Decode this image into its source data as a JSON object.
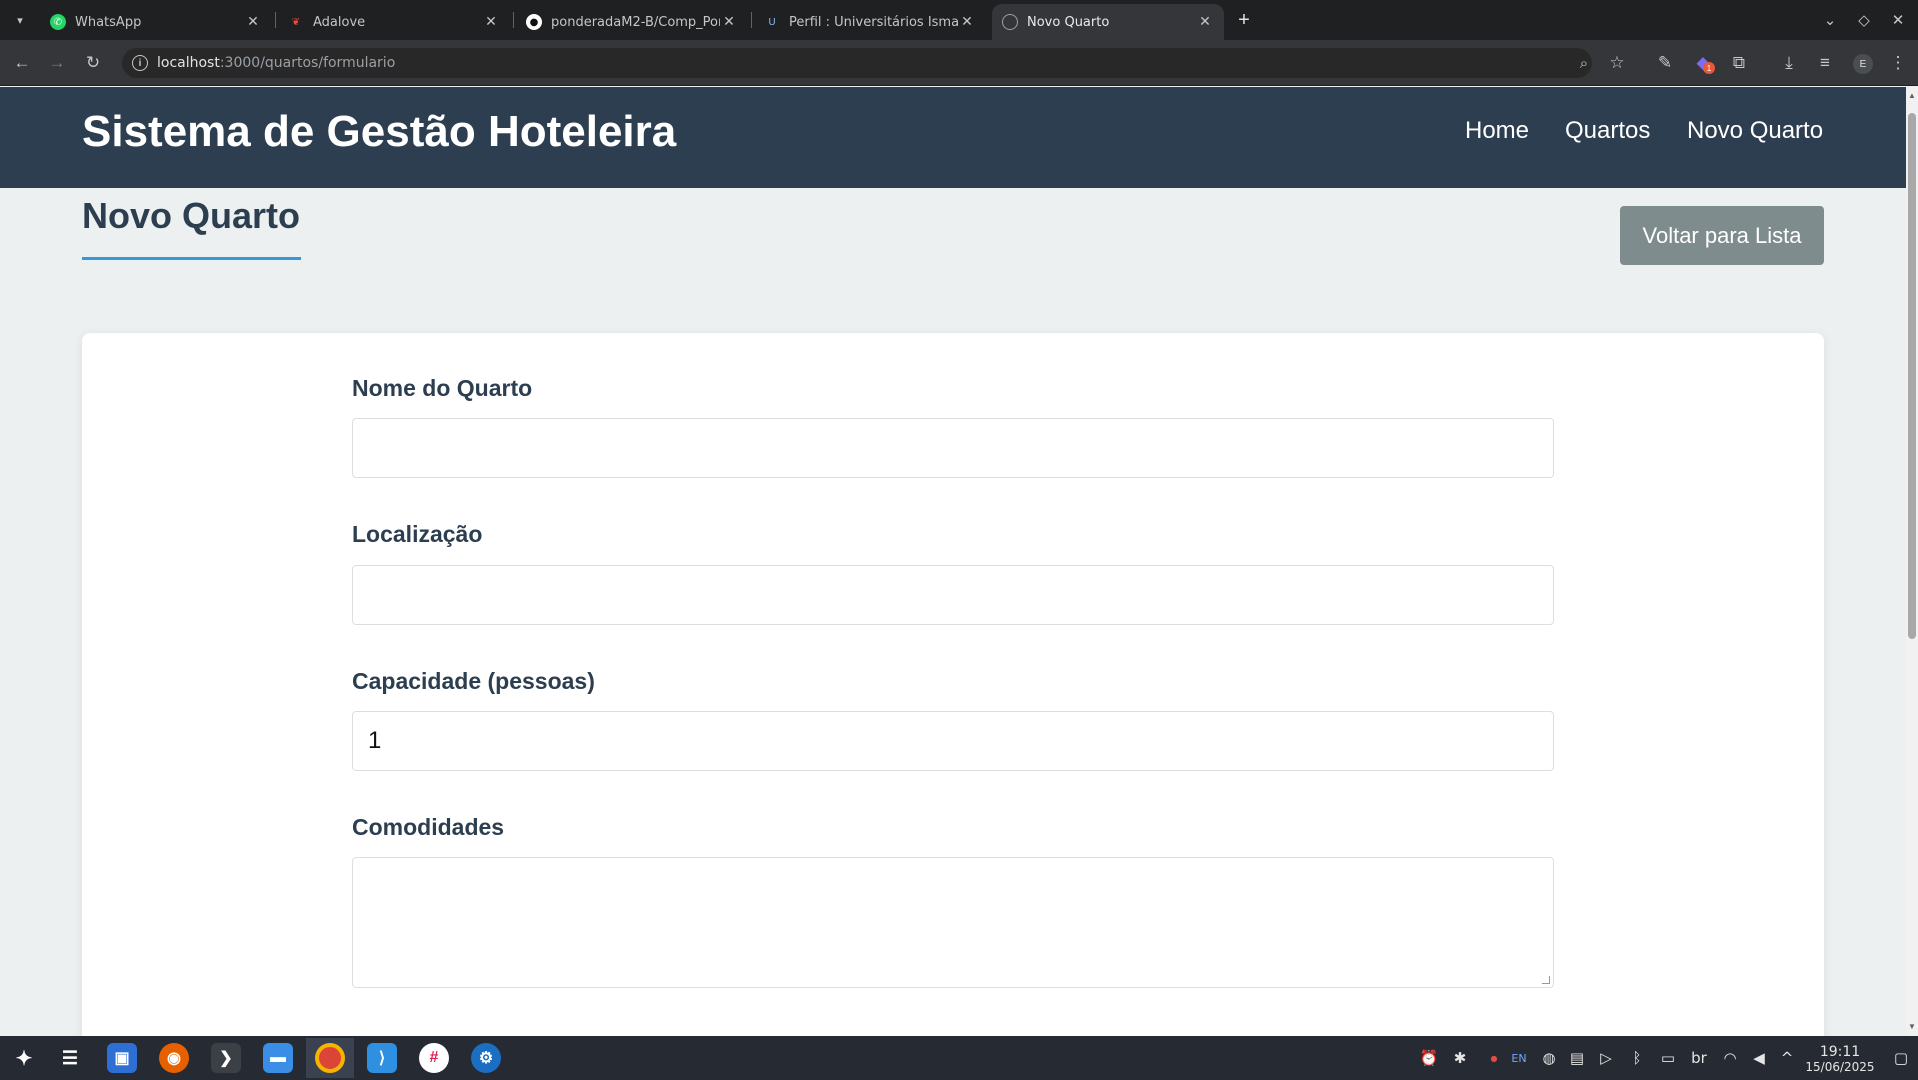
{
  "browser": {
    "tabs": [
      {
        "title": "WhatsApp",
        "icon": "whatsapp-icon",
        "color": "#25d366",
        "active": false
      },
      {
        "title": "Adalove",
        "icon": "adalove-icon",
        "color": "#e74c3c",
        "active": false
      },
      {
        "title": "ponderadaM2-B/Comp_Por",
        "icon": "github-icon",
        "color": "#ffffff",
        "active": false
      },
      {
        "title": "Perfil : Universitários Isma",
        "icon": "edu-icon",
        "color": "#8ab4f8",
        "active": false
      },
      {
        "title": "Novo Quarto",
        "icon": "globe-icon",
        "color": "#9aa0a6",
        "active": true
      }
    ],
    "url_host": "localhost",
    "url_path": ":3000/quartos/formulario",
    "profile_initial": "E",
    "extension_badge": "1"
  },
  "site": {
    "title": "Sistema de Gestão Hoteleira",
    "nav": [
      "Home",
      "Quartos",
      "Novo Quarto"
    ]
  },
  "page": {
    "heading": "Novo Quarto",
    "back_button": "Voltar para Lista"
  },
  "form": {
    "name_label": "Nome do Quarto",
    "name_value": "",
    "location_label": "Localização",
    "location_value": "",
    "capacity_label": "Capacidade (pessoas)",
    "capacity_value": "1",
    "amenities_label": "Comodidades",
    "amenities_value": ""
  },
  "taskbar": {
    "lang": "EN",
    "keyboard": "br",
    "time": "19:11",
    "date": "15/06/2025"
  },
  "colors": {
    "header_bg": "#2c3e50",
    "accent": "#3498db",
    "back_button_bg": "#7f8c8d",
    "page_bg": "#ecf0f1"
  }
}
